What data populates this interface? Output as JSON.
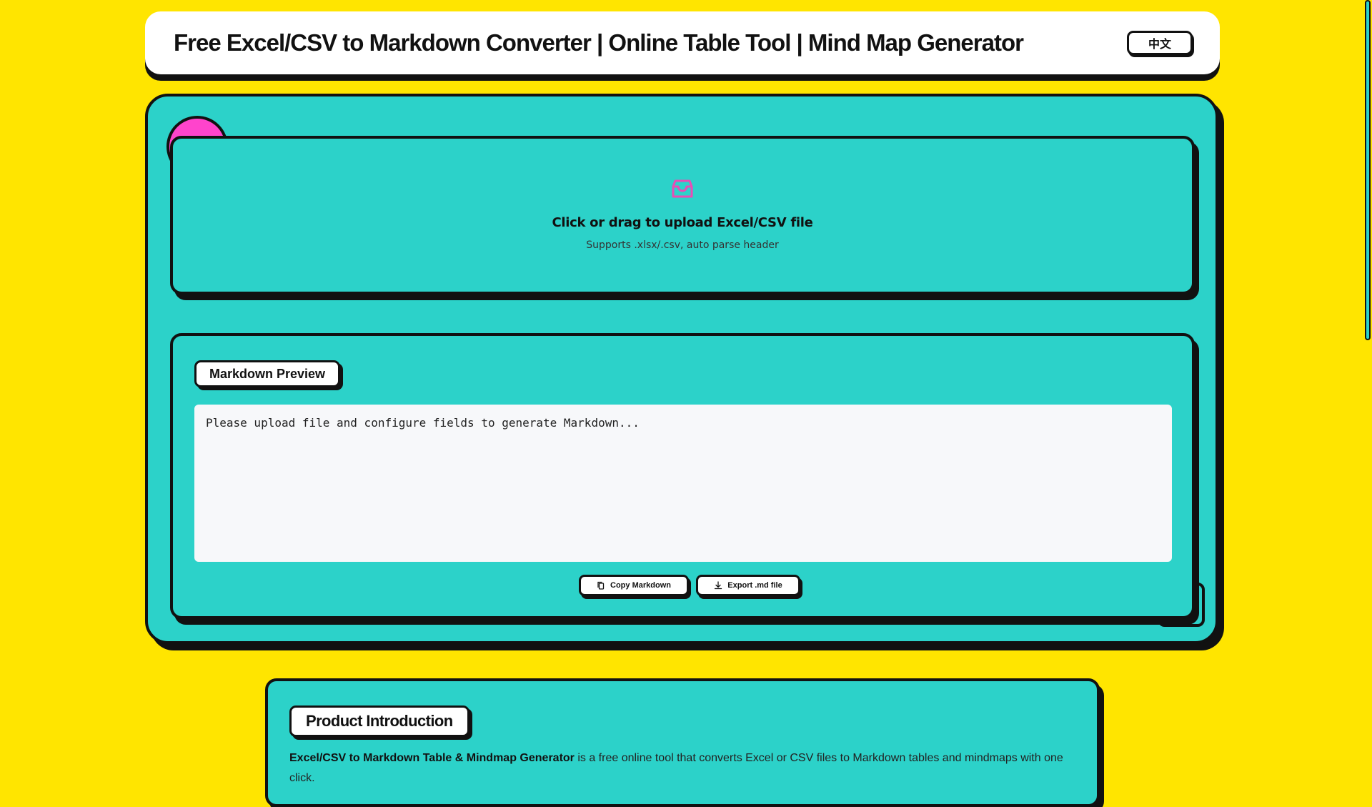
{
  "header": {
    "title": "Free Excel/CSV to Markdown Converter | Online Table Tool | Mind Map Generator",
    "lang_button": "中文"
  },
  "upload": {
    "icon": "inbox-icon",
    "title": "Click or drag to upload Excel/CSV file",
    "subtitle": "Supports .xlsx/.csv, auto parse header"
  },
  "preview": {
    "label": "Markdown Preview",
    "placeholder_text": "Please upload file and configure fields to generate Markdown...",
    "copy_button": "Copy Markdown",
    "copy_icon": "copy-icon",
    "export_button": "Export .md file",
    "export_icon": "download-icon"
  },
  "intro": {
    "label": "Product Introduction",
    "bold_text": "Excel/CSV to Markdown Table & Mindmap Generator",
    "text": " is a free online tool that converts Excel or CSV files to Markdown tables and mindmaps with one click."
  },
  "colors": {
    "background": "#FFE500",
    "panel": "#2CD2C9",
    "accent": "#FF44CC",
    "border": "#111111"
  }
}
